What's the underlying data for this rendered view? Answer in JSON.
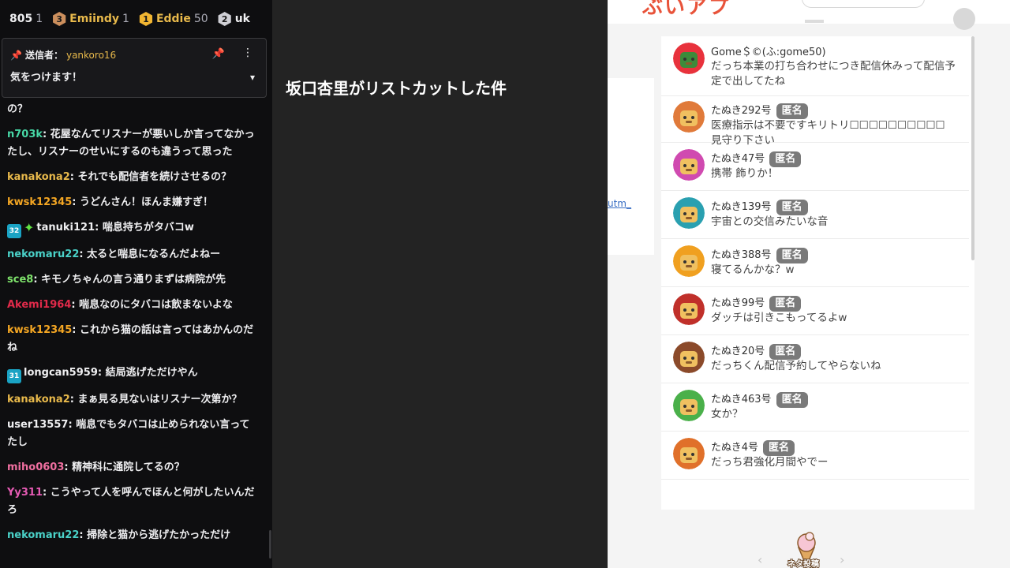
{
  "leaderboard": [
    {
      "name": "805",
      "count": "1"
    },
    {
      "rank": "3",
      "name": "Emiindy",
      "count": "1"
    },
    {
      "rank": "1",
      "name": "Eddie",
      "count": "50"
    },
    {
      "rank": "2",
      "name": "uk",
      "count": ""
    }
  ],
  "pinned": {
    "label": "送信者：",
    "sender": "yankoro16",
    "text": "気をつけます！"
  },
  "chat": [
    {
      "user": "",
      "text": "の？",
      "color": "#efeff1"
    },
    {
      "user": "n703k",
      "text": "花屋なんてリスナーが悪いしか言ってなかったし、リスナーのせいにするのも違うって思った",
      "color": "#47d8a6"
    },
    {
      "user": "kanakona2",
      "text": "それでも配信者を続けさせるの？",
      "color": "#e8b94b"
    },
    {
      "user": "kwsk12345",
      "text": "うどんさん！ほんま嫌すぎ！",
      "color": "#f4a623"
    },
    {
      "user": "tanuki121",
      "text": "喘息持ちがタバコw",
      "color": "#efeff1",
      "sub": "32",
      "star": true
    },
    {
      "user": "nekomaru22",
      "text": "太ると喘息になるんだよねー",
      "color": "#4ad1c8"
    },
    {
      "user": "sce8",
      "text": "キモノちゃんの言う通りまずは病院が先",
      "color": "#7ee36b"
    },
    {
      "user": "Akemi1964",
      "text": "喘息なのにタバコは飲まないよな",
      "color": "#e02a4a"
    },
    {
      "user": "kwsk12345",
      "text": "これから猫の話は言ってはあかんのだね",
      "color": "#f4a623"
    },
    {
      "user": "longcan5959",
      "text": "結局逃げただけやん",
      "color": "#efeff1",
      "sub": "31"
    },
    {
      "user": "kanakona2",
      "text": "まぁ見る見ないはリスナー次第か？",
      "color": "#e8b94b"
    },
    {
      "user": "user13557",
      "text": "喘息でもタバコは止められない言ってたし",
      "color": "#efeff1"
    },
    {
      "user": "miho0603",
      "text": "精神科に通院してるの？",
      "color": "#ef6fa0"
    },
    {
      "user": "Yy311",
      "text": "こうやって人を呼んでほんと何がしたいんだろ",
      "color": "#e65bb4"
    },
    {
      "user": "nekomaru22",
      "text": "掃除と猫から逃げたかっただけ",
      "color": "#4ad1c8"
    }
  ],
  "mid_title": "坂口杏里がリストカットした件",
  "site": {
    "logo_fragment": "ぶいアプ",
    "bg_link": "utm_",
    "nav_label": "ネタ投稿"
  },
  "comments": [
    {
      "name": "Gome＄©(ふ:gome50)",
      "anon": false,
      "text": "だっち本業の打ち合わせにつき配信休みって配信予定で出してたね",
      "avatar": "hibiscus"
    },
    {
      "name": "たぬき292号",
      "anon": true,
      "text": "医療指示は不要ですキリトリ☐☐☐☐☐☐☐☐☐☐見守り下さい",
      "avatar": "tanuki-orange"
    },
    {
      "name": "たぬき47号",
      "anon": true,
      "text": "携帯 飾りか！",
      "avatar": "tanuki-pink"
    },
    {
      "name": "たぬき139号",
      "anon": true,
      "text": "宇宙との交信みたいな音",
      "avatar": "tanuki-teal"
    },
    {
      "name": "たぬき388号",
      "anon": true,
      "text": "寝てるんかな？w",
      "avatar": "tanuki-yellow"
    },
    {
      "name": "たぬき99号",
      "anon": true,
      "text": "ダッチは引きこもってるよw",
      "avatar": "tanuki-red"
    },
    {
      "name": "たぬき20号",
      "anon": true,
      "text": "だっちくん配信予約してやらないね",
      "avatar": "tanuki-brown"
    },
    {
      "name": "たぬき463号",
      "anon": true,
      "text": "女か？",
      "avatar": "tanuki-green"
    },
    {
      "name": "たぬき4号",
      "anon": true,
      "text": "だっち君強化月間やでー",
      "avatar": "tanuki-orange2"
    }
  ],
  "anon_label": "匿名",
  "colors": {
    "chat_bg": "#0e0e10",
    "mid_bg": "#232323",
    "badge": "#7a7a7a",
    "accent": "#e8533a"
  }
}
